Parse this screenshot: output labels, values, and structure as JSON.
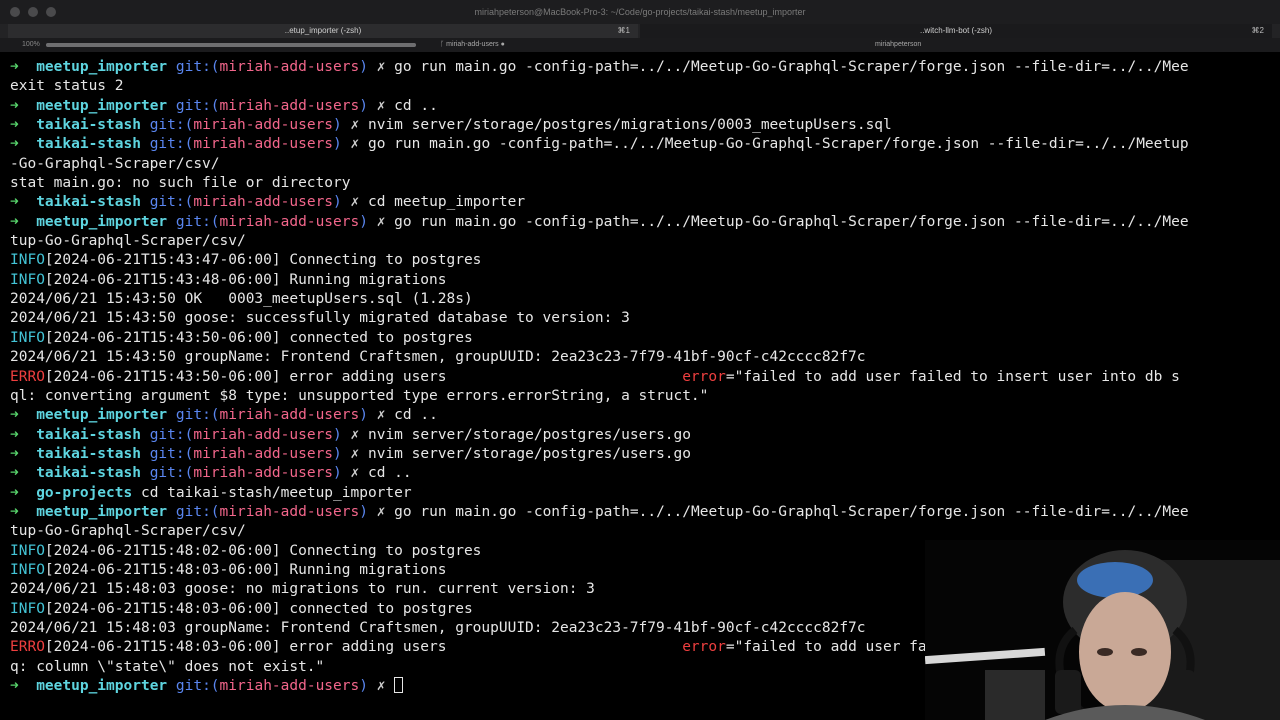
{
  "window": {
    "title": "miriahpeterson@MacBook-Pro-3: ~/Code/go-projects/taikai-stash/meetup_importer"
  },
  "tabs": [
    {
      "label": "..etup_importer (-zsh)",
      "shortcut": "⌘1"
    },
    {
      "label": "..witch-llm-bot (-zsh)",
      "shortcut": "⌘2"
    }
  ],
  "panebar": {
    "zoom": "100%",
    "progress": 1.0,
    "left_label": "ᚴ miriah-add-users ●",
    "right_label": "miriahpeterson"
  },
  "terminal": {
    "prompt_arrow": "➜",
    "git_label": "git:(",
    "git_close": ")",
    "branch": "miriah-add-users",
    "dirty_mark": "✗",
    "lines": [
      {
        "type": "prompt",
        "dir": "meetup_importer",
        "cmd": "go run main.go -config-path=../../Meetup-Go-Graphql-Scraper/forge.json --file-dir=../../Mee"
      },
      {
        "type": "plain",
        "text": "exit status 2"
      },
      {
        "type": "prompt",
        "dir": "meetup_importer",
        "cmd": "cd .."
      },
      {
        "type": "prompt",
        "dir": "taikai-stash",
        "cmd": "nvim server/storage/postgres/migrations/0003_meetupUsers.sql"
      },
      {
        "type": "prompt",
        "dir": "taikai-stash",
        "cmd": "go run main.go -config-path=../../Meetup-Go-Graphql-Scraper/forge.json --file-dir=../../Meetup"
      },
      {
        "type": "plain",
        "text": "-Go-Graphql-Scraper/csv/"
      },
      {
        "type": "plain",
        "text": "stat main.go: no such file or directory"
      },
      {
        "type": "prompt",
        "dir": "taikai-stash",
        "cmd": "cd meetup_importer"
      },
      {
        "type": "prompt",
        "dir": "meetup_importer",
        "cmd": "go run main.go -config-path=../../Meetup-Go-Graphql-Scraper/forge.json --file-dir=../../Mee"
      },
      {
        "type": "plain",
        "text": "tup-Go-Graphql-Scraper/csv/"
      },
      {
        "type": "log",
        "level": "INFO",
        "ts": "[2024-06-21T15:43:47-06:00]",
        "msg": "Connecting to postgres"
      },
      {
        "type": "log",
        "level": "INFO",
        "ts": "[2024-06-21T15:43:48-06:00]",
        "msg": "Running migrations"
      },
      {
        "type": "plain",
        "text": "2024/06/21 15:43:50 OK   0003_meetupUsers.sql (1.28s)"
      },
      {
        "type": "plain",
        "text": "2024/06/21 15:43:50 goose: successfully migrated database to version: 3"
      },
      {
        "type": "log",
        "level": "INFO",
        "ts": "[2024-06-21T15:43:50-06:00]",
        "msg": "connected to postgres"
      },
      {
        "type": "plain",
        "text": "2024/06/21 15:43:50 groupName: Frontend Craftsmen, groupUUID: 2ea23c23-7f79-41bf-90cf-c42cccc82f7c"
      },
      {
        "type": "errlog",
        "level": "ERRO",
        "ts": "[2024-06-21T15:43:50-06:00]",
        "msg": "error adding users",
        "pad": "                           ",
        "key": "error",
        "val": "=\"failed to add user failed to insert user into db s"
      },
      {
        "type": "plain",
        "text": "ql: converting argument $8 type: unsupported type errors.errorString, a struct.\""
      },
      {
        "type": "prompt",
        "dir": "meetup_importer",
        "cmd": "cd .."
      },
      {
        "type": "prompt",
        "dir": "taikai-stash",
        "cmd": "nvim server/storage/postgres/users.go"
      },
      {
        "type": "prompt",
        "dir": "taikai-stash",
        "cmd": "nvim server/storage/postgres/users.go"
      },
      {
        "type": "prompt",
        "dir": "taikai-stash",
        "cmd": "cd .."
      },
      {
        "type": "prompt_nogit",
        "dir": "go-projects",
        "cmd": "cd taikai-stash/meetup_importer"
      },
      {
        "type": "prompt",
        "dir": "meetup_importer",
        "cmd": "go run main.go -config-path=../../Meetup-Go-Graphql-Scraper/forge.json --file-dir=../../Mee"
      },
      {
        "type": "plain",
        "text": "tup-Go-Graphql-Scraper/csv/"
      },
      {
        "type": "log",
        "level": "INFO",
        "ts": "[2024-06-21T15:48:02-06:00]",
        "msg": "Connecting to postgres"
      },
      {
        "type": "log",
        "level": "INFO",
        "ts": "[2024-06-21T15:48:03-06:00]",
        "msg": "Running migrations"
      },
      {
        "type": "plain",
        "text": "2024/06/21 15:48:03 goose: no migrations to run. current version: 3"
      },
      {
        "type": "log",
        "level": "INFO",
        "ts": "[2024-06-21T15:48:03-06:00]",
        "msg": "connected to postgres"
      },
      {
        "type": "plain",
        "text": "2024/06/21 15:48:03 groupName: Frontend Craftsmen, groupUUID: 2ea23c23-7f79-41bf-90cf-c42cccc82f7c"
      },
      {
        "type": "errlog",
        "level": "ERRO",
        "ts": "[2024-06-21T15:48:03-06:00]",
        "msg": "error adding users",
        "pad": "                           ",
        "key": "error",
        "val": "=\"failed to add user fa"
      },
      {
        "type": "plain",
        "text": "q: column \\\"state\\\" does not exist.\""
      },
      {
        "type": "current_prompt",
        "dir": "meetup_importer",
        "cmd": ""
      }
    ]
  },
  "colors": {
    "arrow": "#57d26b",
    "dir": "#5ed5e0",
    "git": "#5a86f0",
    "branch": "#f2668b",
    "info": "#43c4d6",
    "error": "#ee3f3f"
  },
  "icons": [
    "close-icon",
    "branch-icon",
    "user-icon",
    "tab-shortcut-icon"
  ]
}
